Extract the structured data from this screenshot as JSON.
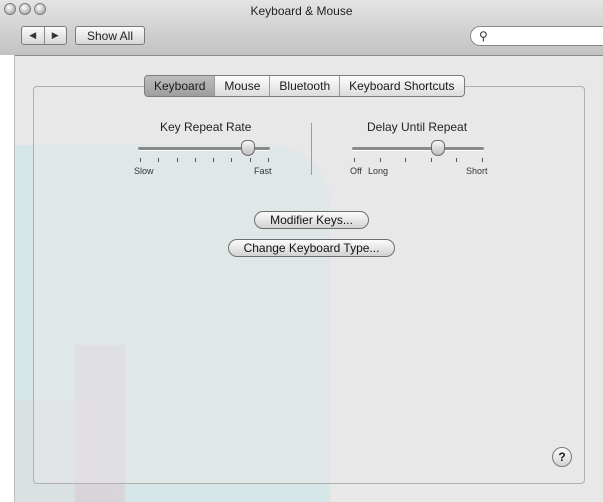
{
  "window": {
    "title": "Keyboard & Mouse",
    "nav_back_icon": "triangle-left-icon",
    "nav_forward_icon": "triangle-right-icon",
    "show_all_label": "Show All",
    "search_icon": "magnifier-icon",
    "search_placeholder": ""
  },
  "tabs": [
    {
      "label": "Keyboard",
      "selected": true
    },
    {
      "label": "Mouse",
      "selected": false
    },
    {
      "label": "Bluetooth",
      "selected": false
    },
    {
      "label": "Keyboard Shortcuts",
      "selected": false
    }
  ],
  "sliders": {
    "key_repeat": {
      "title": "Key Repeat Rate",
      "min_label": "Slow",
      "max_label": "Fast",
      "ticks": 8,
      "value_fraction": 0.83
    },
    "delay_until_repeat": {
      "title": "Delay Until Repeat",
      "min_label": "Off",
      "min_label_2": "Long",
      "max_label": "Short",
      "ticks": 6,
      "value_fraction": 0.65
    }
  },
  "buttons": {
    "modifier_keys": "Modifier Keys...",
    "change_keyboard_type": "Change Keyboard Type...",
    "help": "?"
  },
  "colors": {
    "selected_tab": "#a8a8a8",
    "window_bg": "#e8e8e8"
  }
}
